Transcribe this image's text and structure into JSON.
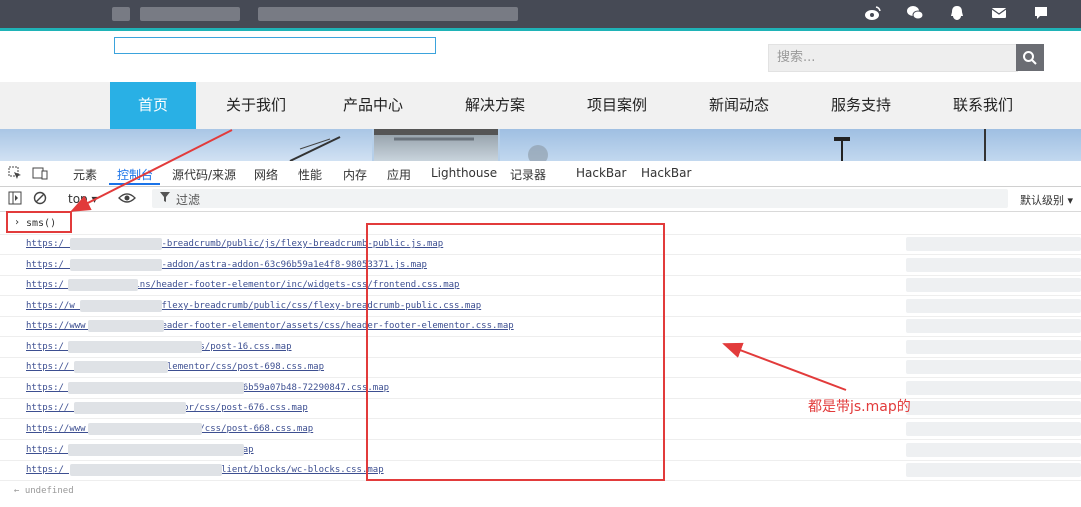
{
  "site": {
    "search_placeholder": "搜索...",
    "nav": [
      "首页",
      "关于我们",
      "产品中心",
      "解决方案",
      "项目案例",
      "新闻动态",
      "服务支持",
      "联系我们"
    ],
    "top_icons": [
      "weibo-icon",
      "wechat-icon",
      "qq-icon",
      "mail-icon",
      "message-icon"
    ]
  },
  "devtools": {
    "tabs": [
      "元素",
      "控制台",
      "源代码/来源",
      "网络",
      "性能",
      "内存",
      "应用",
      "Lighthouse",
      "记录器",
      "HackBar",
      "HackBar"
    ],
    "active_tab": "控制台",
    "context": "top ▾",
    "filter_placeholder": "过滤",
    "level": "默认级别 ▾",
    "input_command": "sms()",
    "output_urls": [
      "https:/                    ent/plugins/flexy-breadcrumb/public/js/flexy-breadcrumb-public.js.map",
      "https:/                    ent/uploads/astra-addon/astra-addon-63c96b59a1e4f8-98053371.js.map",
      "https:/                content/plugins/header-footer-elementor/inc/widgets-css/frontend.css.map",
      "https://w                 ontent/plugins/flexy-breadcrumb/public/css/flexy-breadcrumb-public.css.map",
      "https://www                ent/plugins/header-footer-elementor/assets/css/header-footer-elementor.css.map",
      "https:/                   ..t/uploads/elementor/css/post-16.css.map",
      "https://               content/uploads/elementor/css/post-698.css.map",
      "https:/                   ads/astra-addon/astra-addon-63c96b59a07b48-72290847.css.map",
      "https://                 tent/uploads/elementor/css/post-676.css.map",
      "https://www              nt/uploads/elementor/css/post-668.css.map",
      "https:/                   t/themes/astra-child/style.css.map",
      "https:/                 plugins/woocommerce/assets/client/blocks/wc-blocks.css.map"
    ],
    "result": "undefined"
  },
  "annotation": {
    "note": "都是带js.map的",
    "color": "#e23b3b"
  }
}
